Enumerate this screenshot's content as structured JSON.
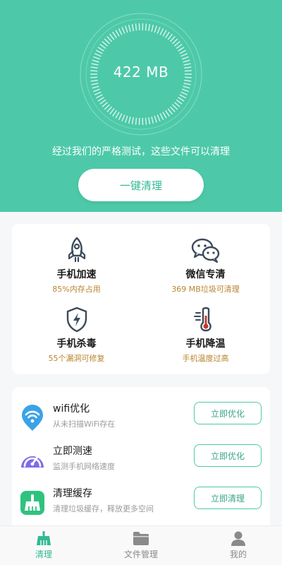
{
  "theme": {
    "accent": "#4dc9a9",
    "accent_dark": "#32b994",
    "sub_text_gold": "#b7852d",
    "inactive": "#8a8a8a"
  },
  "hero": {
    "memory_value": "422 MB",
    "message": "经过我们的严格测试，这些文件可以清理",
    "clean_button_label": "一键清理"
  },
  "features": [
    {
      "icon": "rocket-icon",
      "title": "手机加速",
      "subtitle": "85%内存占用"
    },
    {
      "icon": "wechat-icon",
      "title": "微信专清",
      "subtitle": "369 MB垃圾可清理"
    },
    {
      "icon": "shield-lightning-icon",
      "title": "手机杀毒",
      "subtitle": "55个漏洞可修复"
    },
    {
      "icon": "thermometer-icon",
      "title": "手机降温",
      "subtitle": "手机温度过高"
    }
  ],
  "tools": [
    {
      "icon": "wifi-icon",
      "title": "wifi优化",
      "subtitle": "从未扫描WiFi存在",
      "button": "立即优化"
    },
    {
      "icon": "speedometer-icon",
      "title": "立即测速",
      "subtitle": "监测手机网络速度",
      "button": "立即优化"
    },
    {
      "icon": "broom-icon",
      "title": "清理缓存",
      "subtitle": "清理垃圾缓存，释放更多空间",
      "button": "立即清理"
    }
  ],
  "nav": [
    {
      "icon": "broom-icon",
      "label": "清理",
      "active": true
    },
    {
      "icon": "folder-icon",
      "label": "文件管理",
      "active": false
    },
    {
      "icon": "user-icon",
      "label": "我的",
      "active": false
    }
  ]
}
